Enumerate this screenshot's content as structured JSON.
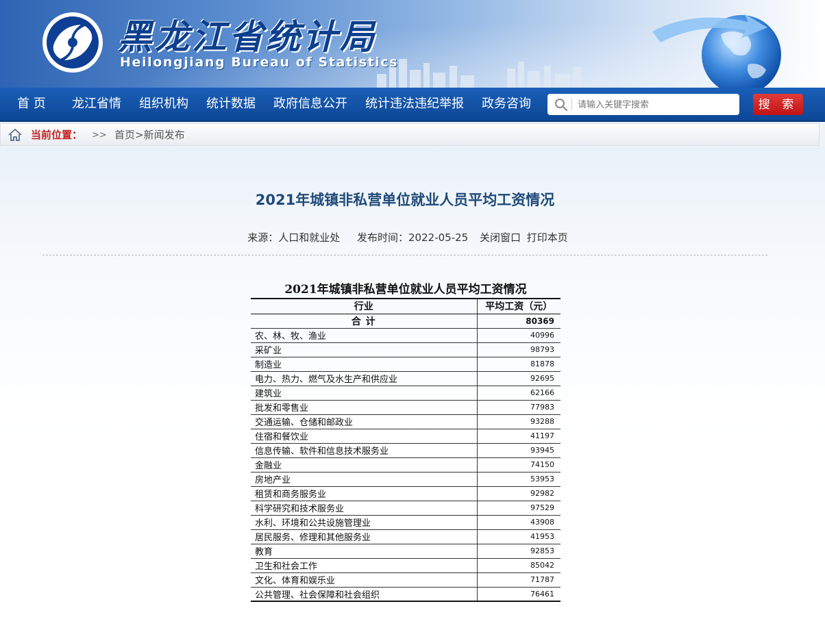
{
  "header": {
    "title_cn": "黑龙江省统计局",
    "title_en": "Heilongjiang Bureau of Statistics"
  },
  "nav": {
    "items": [
      {
        "label": "首  页"
      },
      {
        "label": "龙江省情"
      },
      {
        "label": "组织机构"
      },
      {
        "label": "统计数据"
      },
      {
        "label": "政府信息公开"
      },
      {
        "label": "统计违法违纪举报"
      },
      {
        "label": "政务咨询"
      }
    ],
    "search_placeholder": "请输入关键字搜索",
    "search_button": "搜 索"
  },
  "breadcrumb": {
    "label": "当前位置：",
    "arrows": ">>",
    "path": "首页>新闻发布"
  },
  "article": {
    "title": "2021年城镇非私营单位就业人员平均工资情况",
    "source": "来源：人口和就业处",
    "publish_time": "发布时间：2022-05-25",
    "close_link": "关闭窗口",
    "print_link": "打印本页"
  },
  "table": {
    "caption": "2021年城镇非私营单位就业人员平均工资情况",
    "col_industry": "行业",
    "col_wage": "平均工资（元）",
    "total_label": "合    计",
    "total_value": "80369",
    "rows": [
      {
        "industry": "农、林、牧、渔业",
        "wage": "40996"
      },
      {
        "industry": "采矿业",
        "wage": "98793"
      },
      {
        "industry": "制造业",
        "wage": "81878"
      },
      {
        "industry": "电力、热力、燃气及水生产和供应业",
        "wage": "92695"
      },
      {
        "industry": "建筑业",
        "wage": "62166"
      },
      {
        "industry": "批发和零售业",
        "wage": "77983"
      },
      {
        "industry": "交通运输、仓储和邮政业",
        "wage": "93288"
      },
      {
        "industry": "住宿和餐饮业",
        "wage": "41197"
      },
      {
        "industry": "信息传输、软件和信息技术服务业",
        "wage": "93945"
      },
      {
        "industry": "金融业",
        "wage": "74150"
      },
      {
        "industry": "房地产业",
        "wage": "53953"
      },
      {
        "industry": "租赁和商务服务业",
        "wage": "92982"
      },
      {
        "industry": "科学研究和技术服务业",
        "wage": "97529"
      },
      {
        "industry": "水利、环境和公共设施管理业",
        "wage": "43908"
      },
      {
        "industry": "居民服务、修理和其他服务业",
        "wage": "41953"
      },
      {
        "industry": "教育",
        "wage": "92853"
      },
      {
        "industry": "卫生和社会工作",
        "wage": "85042"
      },
      {
        "industry": "文化、体育和娱乐业",
        "wage": "71787"
      },
      {
        "industry": "公共管理、社会保障和社会组织",
        "wage": "76461"
      }
    ]
  },
  "colors": {
    "nav_blue": "#1255aa",
    "search_red": "#c81a1a",
    "title_blue": "#1f4a79",
    "crumb_red": "#c21f1f"
  }
}
